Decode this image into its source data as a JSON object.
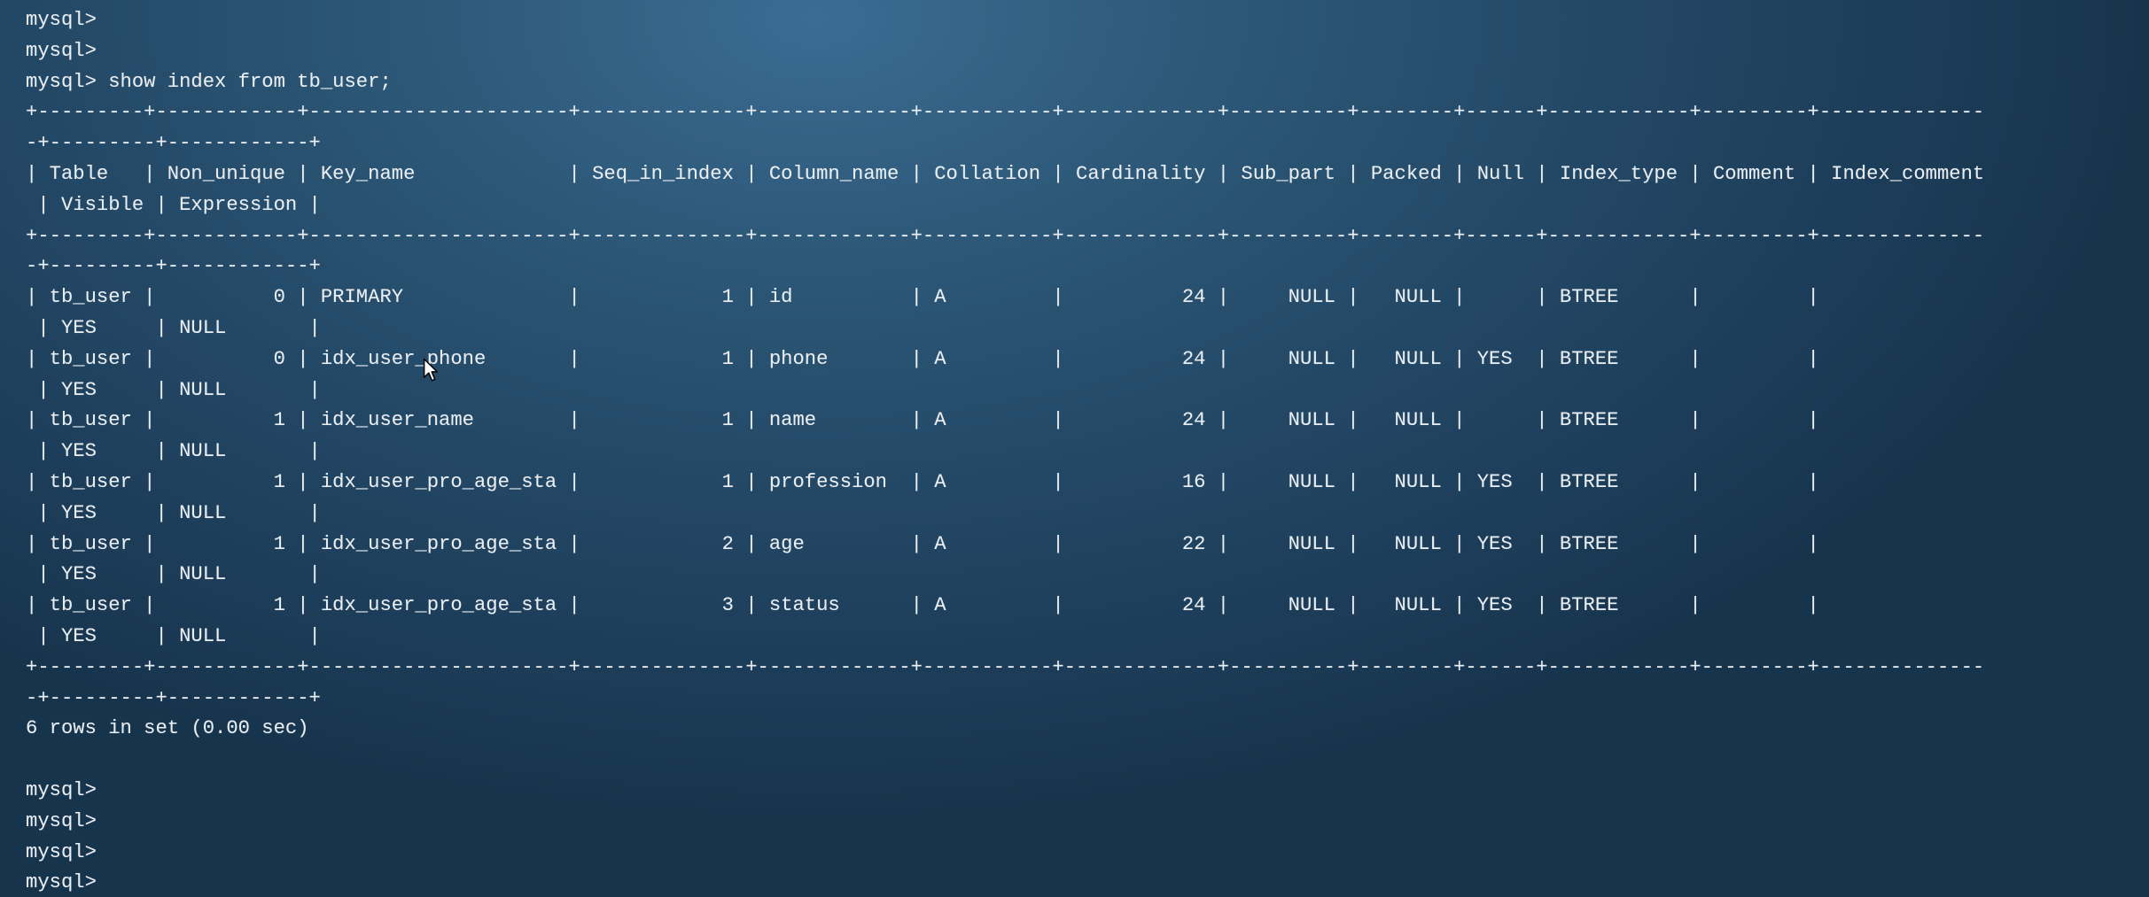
{
  "terminal": {
    "lines": [
      "mysql>",
      "mysql>",
      "mysql> show index from tb_user;",
      "+---------+------------+----------------------+--------------+-------------+-----------+-------------+----------+--------+------+------------+---------+--------------",
      "-+---------+------------+",
      "| Table   | Non_unique | Key_name             | Seq_in_index | Column_name | Collation | Cardinality | Sub_part | Packed | Null | Index_type | Comment | Index_comment",
      " | Visible | Expression |",
      "+---------+------------+----------------------+--------------+-------------+-----------+-------------+----------+--------+------+------------+---------+--------------",
      "-+---------+------------+",
      "| tb_user |          0 | PRIMARY              |            1 | id          | A         |          24 |     NULL |   NULL |      | BTREE      |         |",
      " | YES     | NULL       |",
      "| tb_user |          0 | idx_user_phone       |            1 | phone       | A         |          24 |     NULL |   NULL | YES  | BTREE      |         |",
      " | YES     | NULL       |",
      "| tb_user |          1 | idx_user_name        |            1 | name        | A         |          24 |     NULL |   NULL |      | BTREE      |         |",
      " | YES     | NULL       |",
      "| tb_user |          1 | idx_user_pro_age_sta |            1 | profession  | A         |          16 |     NULL |   NULL | YES  | BTREE      |         |",
      " | YES     | NULL       |",
      "| tb_user |          1 | idx_user_pro_age_sta |            2 | age         | A         |          22 |     NULL |   NULL | YES  | BTREE      |         |",
      " | YES     | NULL       |",
      "| tb_user |          1 | idx_user_pro_age_sta |            3 | status      | A         |          24 |     NULL |   NULL | YES  | BTREE      |         |",
      " | YES     | NULL       |",
      "+---------+------------+----------------------+--------------+-------------+-----------+-------------+----------+--------+------+------------+---------+--------------",
      "-+---------+------------+",
      "6 rows in set (0.00 sec)",
      "",
      "mysql>",
      "mysql>",
      "mysql>",
      "mysql>"
    ],
    "cursor_icon": "mouse-pointer-icon"
  }
}
